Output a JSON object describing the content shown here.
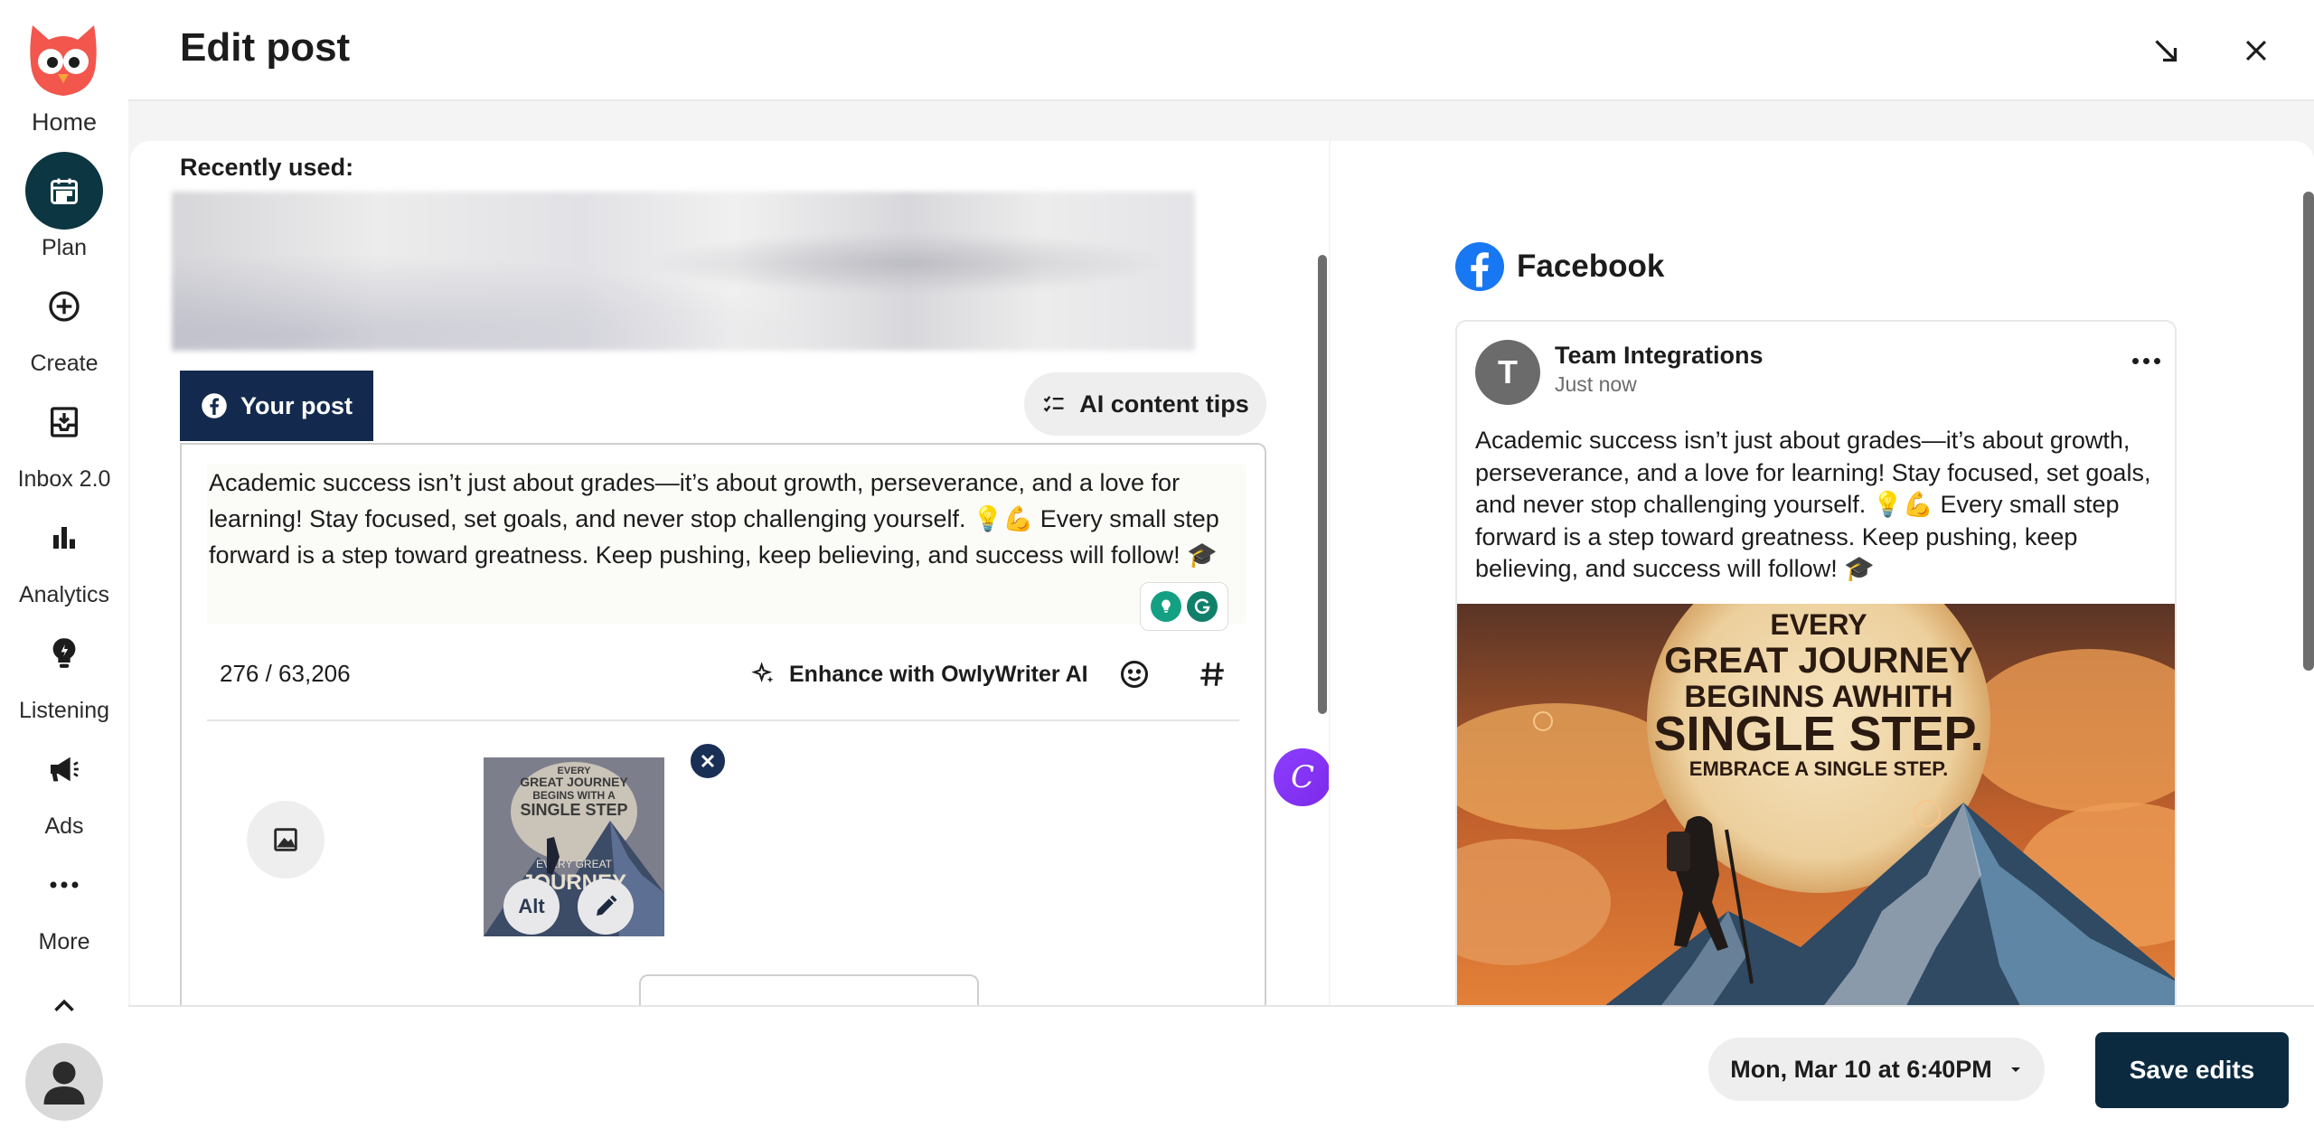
{
  "header": {
    "title": "Edit post"
  },
  "sidebar": {
    "home_label": "Home",
    "items": [
      {
        "label": "Plan",
        "icon": "calendar-icon",
        "active": true
      },
      {
        "label": "Create",
        "icon": "plus-circle-icon"
      },
      {
        "label": "Inbox 2.0",
        "icon": "inbox-icon"
      },
      {
        "label": "Analytics",
        "icon": "bar-chart-icon"
      },
      {
        "label": "Listening",
        "icon": "lightbulb-icon"
      },
      {
        "label": "Ads",
        "icon": "megaphone-icon"
      },
      {
        "label": "More",
        "icon": "more-dots-icon"
      }
    ]
  },
  "composer": {
    "recent_label": "Recently used:",
    "tab_label": "Your post",
    "ai_tips_label": "AI content tips",
    "post_text": "Academic success isn’t just about grades—it’s about growth, perseverance, and a love for learning! Stay focused, set goals, and never stop challenging yourself. 💡💪 Every small step forward is a step toward greatness. Keep pushing, keep believing, and success will follow! 🎓",
    "char_count": "276 / 63,206",
    "enhance_label": "Enhance with OwlyWriter AI",
    "alt_label": "Alt",
    "canva_letter": "C"
  },
  "preview": {
    "network": "Facebook",
    "account_name": "Team Integrations",
    "avatar_letter": "T",
    "timestamp": "Just now",
    "post_text": "Academic success isn’t just about grades—it’s about growth, perseverance, and a love for learning! Stay focused, set goals, and never stop challenging yourself. 💡💪 Every small step forward is a step toward greatness. Keep pushing, keep believing, and success will follow! 🎓",
    "image_text": {
      "line1": "EVERY",
      "line2": "GREAT JOURNEY",
      "line3": "BEGINNS AWHITH",
      "line4": "SINGLE STEP.",
      "line5": "EMBRACE A SINGLE STEP."
    }
  },
  "footer": {
    "schedule": "Mon, Mar 10 at 6:40PM",
    "save_label": "Save edits"
  },
  "colors": {
    "sidebar_active": "#0c3641",
    "your_post_tab": "#132a4e",
    "save_button": "#0c2a3f",
    "facebook_blue": "#1877f2",
    "canva_purple": "#8b3dff",
    "owl_red": "#f2564d"
  }
}
